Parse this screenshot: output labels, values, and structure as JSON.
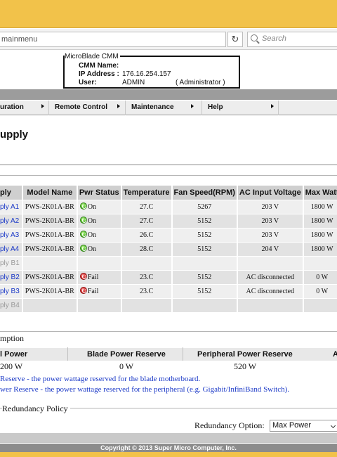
{
  "browser": {
    "url": "mainmenu",
    "search_placeholder": "Search"
  },
  "cmm_info": {
    "title": "MicroBlade CMM",
    "name_label": "CMM Name:",
    "name_value": "",
    "ip_label": "IP Address :",
    "ip_value": "176.16.254.157",
    "user_label": "User:",
    "user_value": "ADMIN",
    "user_role": "( Administrator )"
  },
  "menu": {
    "items": [
      {
        "label": "uration"
      },
      {
        "label": "Remote Control"
      },
      {
        "label": "Maintenance"
      },
      {
        "label": "Help"
      }
    ]
  },
  "page": {
    "title": "upply"
  },
  "table": {
    "headers": [
      "ply",
      "Model Name",
      "Pwr Status",
      "Temperature",
      "Fan Speed(RPM)",
      "AC Input Voltage",
      "Max Watt"
    ],
    "rows": [
      {
        "name": "ply A1",
        "model": "PWS-2K01A-BR",
        "status": "On",
        "status_kind": "ok",
        "temp": "27.C",
        "fan": "5267",
        "voltage": "203 V",
        "max": "1800 W",
        "present": true
      },
      {
        "name": "ply A2",
        "model": "PWS-2K01A-BR",
        "status": "On",
        "status_kind": "ok",
        "temp": "27.C",
        "fan": "5152",
        "voltage": "203 V",
        "max": "1800 W",
        "present": true
      },
      {
        "name": "ply A3",
        "model": "PWS-2K01A-BR",
        "status": "On",
        "status_kind": "ok",
        "temp": "26.C",
        "fan": "5152",
        "voltage": "203 V",
        "max": "1800 W",
        "present": true
      },
      {
        "name": "ply A4",
        "model": "PWS-2K01A-BR",
        "status": "On",
        "status_kind": "ok",
        "temp": "28.C",
        "fan": "5152",
        "voltage": "204 V",
        "max": "1800 W",
        "present": true
      },
      {
        "name": "ply B1",
        "model": "",
        "status": "",
        "status_kind": "",
        "temp": "",
        "fan": "",
        "voltage": "",
        "max": "",
        "present": false
      },
      {
        "name": "ply B2",
        "model": "PWS-2K01A-BR",
        "status": "Fail",
        "status_kind": "fail",
        "temp": "23.C",
        "fan": "5152",
        "voltage": "AC disconnected",
        "max": "0 W",
        "present": true
      },
      {
        "name": "ply B3",
        "model": "PWS-2K01A-BR",
        "status": "Fail",
        "status_kind": "fail",
        "temp": "23.C",
        "fan": "5152",
        "voltage": "AC disconnected",
        "max": "0 W",
        "present": true
      },
      {
        "name": "ply B4",
        "model": "",
        "status": "",
        "status_kind": "",
        "temp": "",
        "fan": "",
        "voltage": "",
        "max": "",
        "present": false
      }
    ]
  },
  "consumption": {
    "section_label": "mption",
    "total_label": "l Power",
    "total_value": "200 W",
    "blade_label": "Blade Power Reserve",
    "blade_value": "0 W",
    "peripheral_label": "Peripheral Power Reserve",
    "peripheral_value": "520 W",
    "extra_label": "A",
    "note1": "Reserve - the power wattage reserved for the blade motherboard.",
    "note2": "wer Reserve - the power wattage reserved for the peripheral (e.g. Gigabit/InfiniBand Switch)."
  },
  "redundancy": {
    "section_label": "Redundancy Policy",
    "option_label": "Redundancy Option:",
    "option_value": "Max Power"
  },
  "footer": {
    "copyright": "Copyright © 2013 Super Micro Computer, Inc."
  },
  "colors": {
    "accent_gold": "#f2c24a",
    "link_blue": "#1b39c7",
    "status_ok": "#3fae1a",
    "status_fail": "#c41414"
  }
}
